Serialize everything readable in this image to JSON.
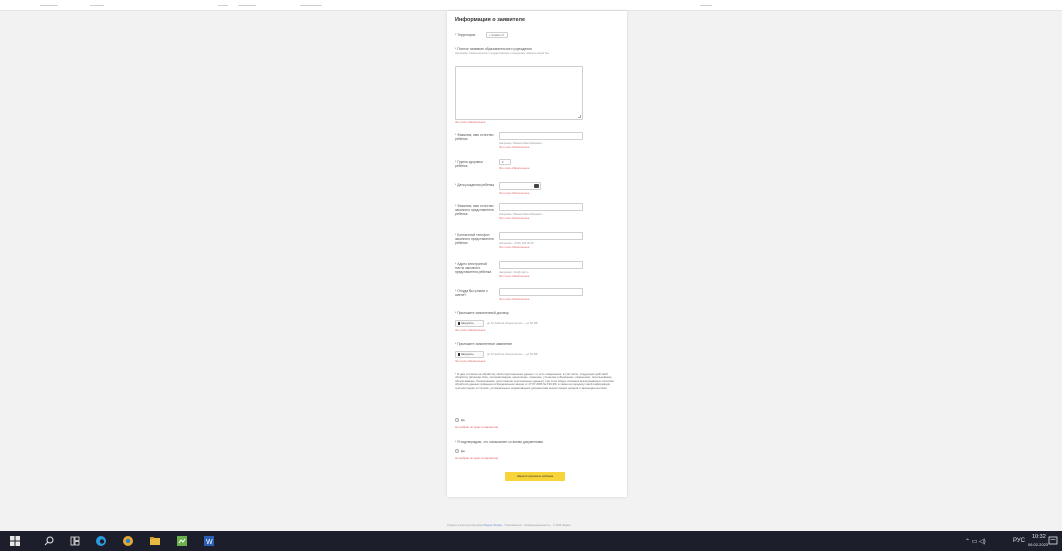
{
  "form": {
    "title": "Информация о заявителе",
    "territory_label": "Территория",
    "territory_value": "г. Алматы ▾",
    "edu_label": "Полное название образовательного учреждения",
    "edu_hint": "Например: Коммунальное государственное учреждение «Школа-лицей №»",
    "required_msg": "Это поле обязательное",
    "child_name_label": "Фамилия, имя отчество ребенка",
    "name_hint": "Например: Иванов Иван Иванович",
    "health_label": "Группа здоровья ребенка",
    "health_value": "▾",
    "birth_label": "Дата рождения ребенка",
    "parent_name_label": "Фамилия, имя отчество законного представителя ребенка",
    "phone_label": "Контактный телефон законного представителя ребенка",
    "phone_hint": "Например: +7(00) 000 00 00",
    "email_label": "Адрес электронной почты законного представителя ребенка",
    "email_hint": "Например: info@mail.ru",
    "source_label": "Откуда Вы узнали о смене?",
    "contract_label": "Приложите заполненный договор",
    "upload_label": "Загрузить",
    "upload_hint": "до 10 файлов общим весом — до 50 МБ",
    "application_label": "Приложите заполненное заявление",
    "consent_text": "Я даю согласие на обработку своих персональных данных, то есть совершение, в том числе, следующих действий: обработку (включая сбор, систематизацию, накопление, хранение, уточнение (обновление, изменение), использование, обезличивание, блокирование, уничтожение персональных данных), при этом общее описание вышеуказанных способов обработки данных приведено в Федеральном законе от 27.07.2006 № 152-ФЗ, а также на передачу такой информации третьим лицам, в случаях, установленных нормативными документами вышестоящих органов и законодательством.",
    "yes_label": "Да",
    "no_choice_msg": "Не выбран ни один из вариантов",
    "confirm_label": "Я подтверждаю, что ознакомлен со всеми документами",
    "submit_label": "Зарегистрировать ребенка"
  },
  "footer": {
    "text": "Создано в конструкторе форм",
    "link": "Яндекс Формы",
    "rest": "· Пожаловаться · Конфиденциальность · © 2023 Яндекс"
  },
  "taskbar": {
    "lang": "РУС",
    "time": "10:32",
    "date": "06.02.2023"
  },
  "colors": {
    "error": "#e06060",
    "submit": "#f7d43a",
    "taskbar": "#1c1f2b"
  }
}
